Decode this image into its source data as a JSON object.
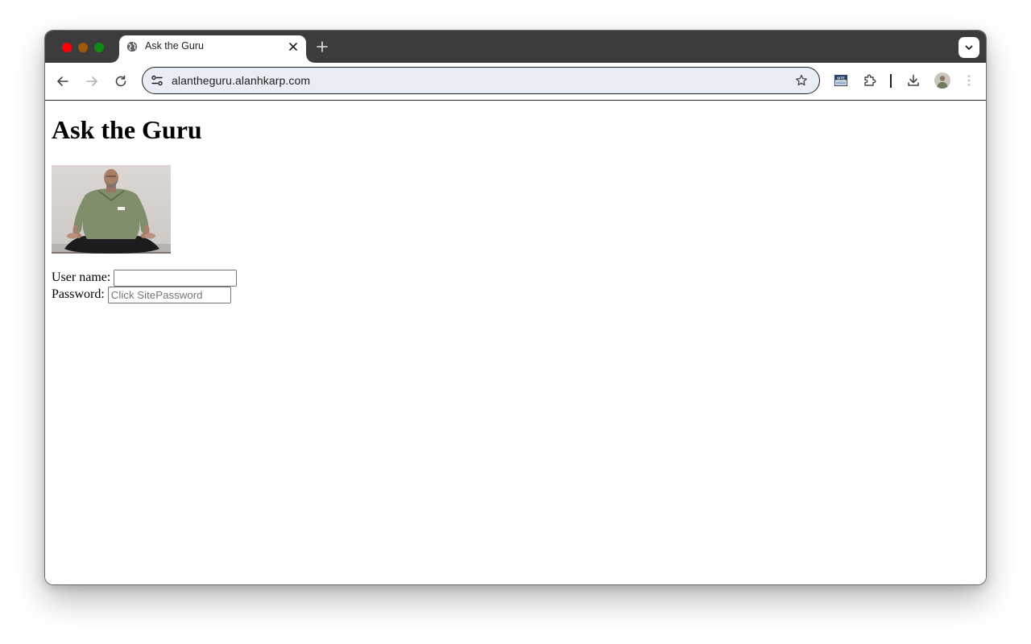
{
  "browser": {
    "tab": {
      "title": "Ask the Guru",
      "favicon": "globe-icon"
    },
    "address_bar": {
      "url": "alantheguru.alanhkarp.com"
    },
    "icons": [
      "back-arrow-icon",
      "forward-arrow-icon",
      "reload-icon",
      "site-info-icon",
      "star-icon",
      "sitepassword-extension-icon",
      "extensions-puzzle-icon",
      "download-icon",
      "profile-avatar",
      "more-menu-icon"
    ]
  },
  "page": {
    "heading": "Ask the Guru",
    "photo": {
      "description": "guru-photo"
    },
    "form": {
      "username_label": "User name:",
      "username_value": "",
      "password_label": "Password:",
      "password_placeholder": "Click SitePassword"
    }
  }
}
